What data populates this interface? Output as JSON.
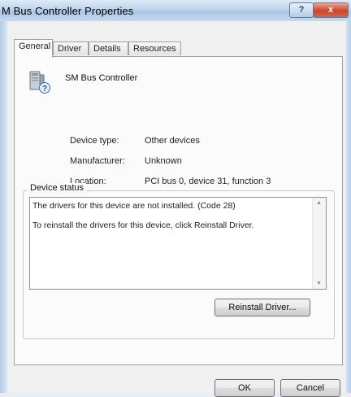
{
  "window": {
    "title": "M Bus Controller Properties",
    "help_glyph": "?",
    "close_glyph": "x"
  },
  "tabs": [
    {
      "label": "General",
      "active": true
    },
    {
      "label": "Driver",
      "active": false
    },
    {
      "label": "Details",
      "active": false
    },
    {
      "label": "Resources",
      "active": false
    }
  ],
  "device": {
    "name": "SM Bus Controller",
    "icon": "device-question-icon",
    "properties": [
      {
        "label": "Device type:",
        "value": "Other devices"
      },
      {
        "label": "Manufacturer:",
        "value": "Unknown"
      },
      {
        "label": "Location:",
        "value": "PCI bus 0, device 31, function 3"
      }
    ]
  },
  "status": {
    "group_label": "Device status",
    "lines": [
      "The drivers for this device are not installed. (Code 28)",
      "To reinstall the drivers for this device, click Reinstall Driver."
    ]
  },
  "buttons": {
    "reinstall": "Reinstall Driver...",
    "ok": "OK",
    "cancel": "Cancel"
  }
}
